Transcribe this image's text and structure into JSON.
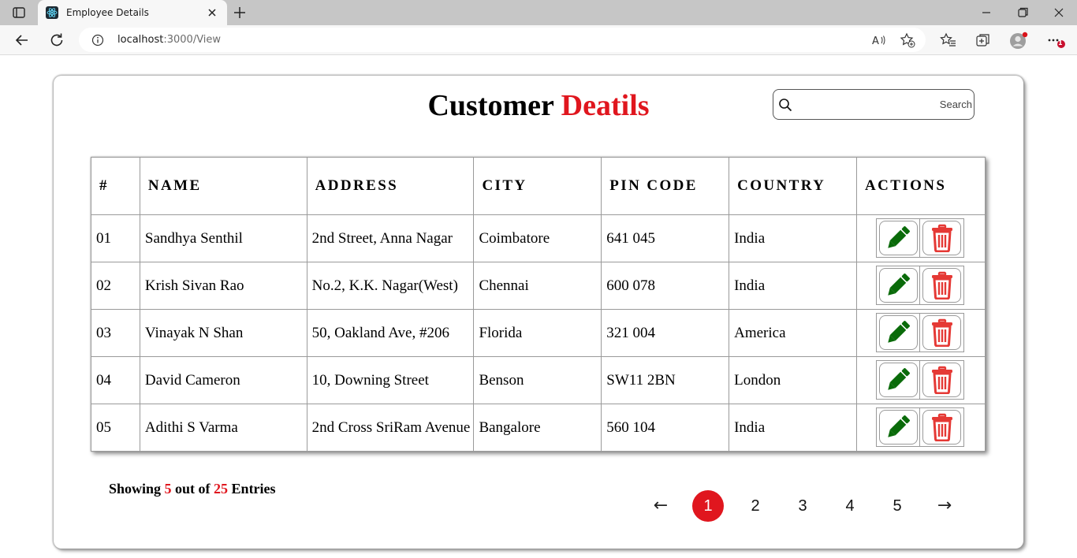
{
  "browser": {
    "tab_title": "Employee Details",
    "url_host": "localhost",
    "url_rest": ":3000/View",
    "notification_badge": "1"
  },
  "page": {
    "title_main": "Customer",
    "title_accent": "Deatils",
    "accent_color": "#e0161e",
    "search_placeholder": "Search"
  },
  "table": {
    "headers": [
      "#",
      "NAME",
      "ADDRESS",
      "CITY",
      "PIN CODE",
      "COUNTRY",
      "ACTIONS"
    ],
    "rows": [
      {
        "id": "01",
        "name": "Sandhya Senthil",
        "address": "2nd Street, Anna Nagar",
        "city": "Coimbatore",
        "pin": "641 045",
        "country": "India"
      },
      {
        "id": "02",
        "name": "Krish Sivan Rao",
        "address": "No.2, K.K. Nagar(West)",
        "city": "Chennai",
        "pin": "600 078",
        "country": "India"
      },
      {
        "id": "03",
        "name": "Vinayak N Shan",
        "address": "50, Oakland Ave, #206",
        "city": "Florida",
        "pin": "321 004",
        "country": "America"
      },
      {
        "id": "04",
        "name": "David Cameron",
        "address": "10, Downing Street",
        "city": "Benson",
        "pin": "SW11 2BN",
        "country": "London"
      },
      {
        "id": "05",
        "name": "Adithi S Varma",
        "address": "2nd Cross SriRam Avenue",
        "city": "Bangalore",
        "pin": "560 104",
        "country": "India"
      }
    ],
    "edit_icon": "pencil-icon",
    "delete_icon": "trash-icon",
    "edit_color": "#0a6b0a",
    "delete_color": "#e53935"
  },
  "footer": {
    "showing_prefix": "Showing",
    "shown_count": "5",
    "out_of": "out of",
    "total": "25",
    "entries": "Entries"
  },
  "pagination": {
    "prev": "←",
    "next": "→",
    "pages": [
      "1",
      "2",
      "3",
      "4",
      "5"
    ],
    "current": "1"
  }
}
